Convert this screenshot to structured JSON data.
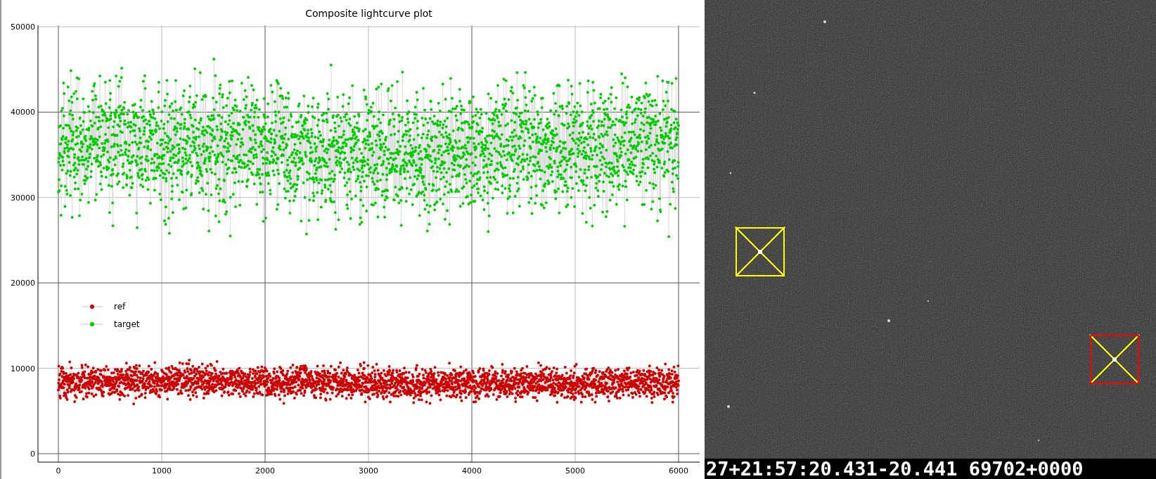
{
  "plot": {
    "title": "Composite lightcurve plot",
    "y_tick_labels": [
      "50000",
      "40000",
      "30000",
      "20000",
      "10000",
      "0"
    ],
    "x_tick_labels": [
      "0",
      "1000",
      "2000",
      "3000",
      "4000",
      "5000",
      "6000"
    ],
    "legend": [
      {
        "label": "ref",
        "color": "#cc0000"
      },
      {
        "label": "target",
        "color": "#00cc00"
      }
    ]
  },
  "image_view": {
    "markers": [
      {
        "color": "#ffff00"
      },
      {
        "color": "#ff0000"
      }
    ],
    "timestamp": "27+21:57:20.431-20.441 69702+0000"
  }
}
